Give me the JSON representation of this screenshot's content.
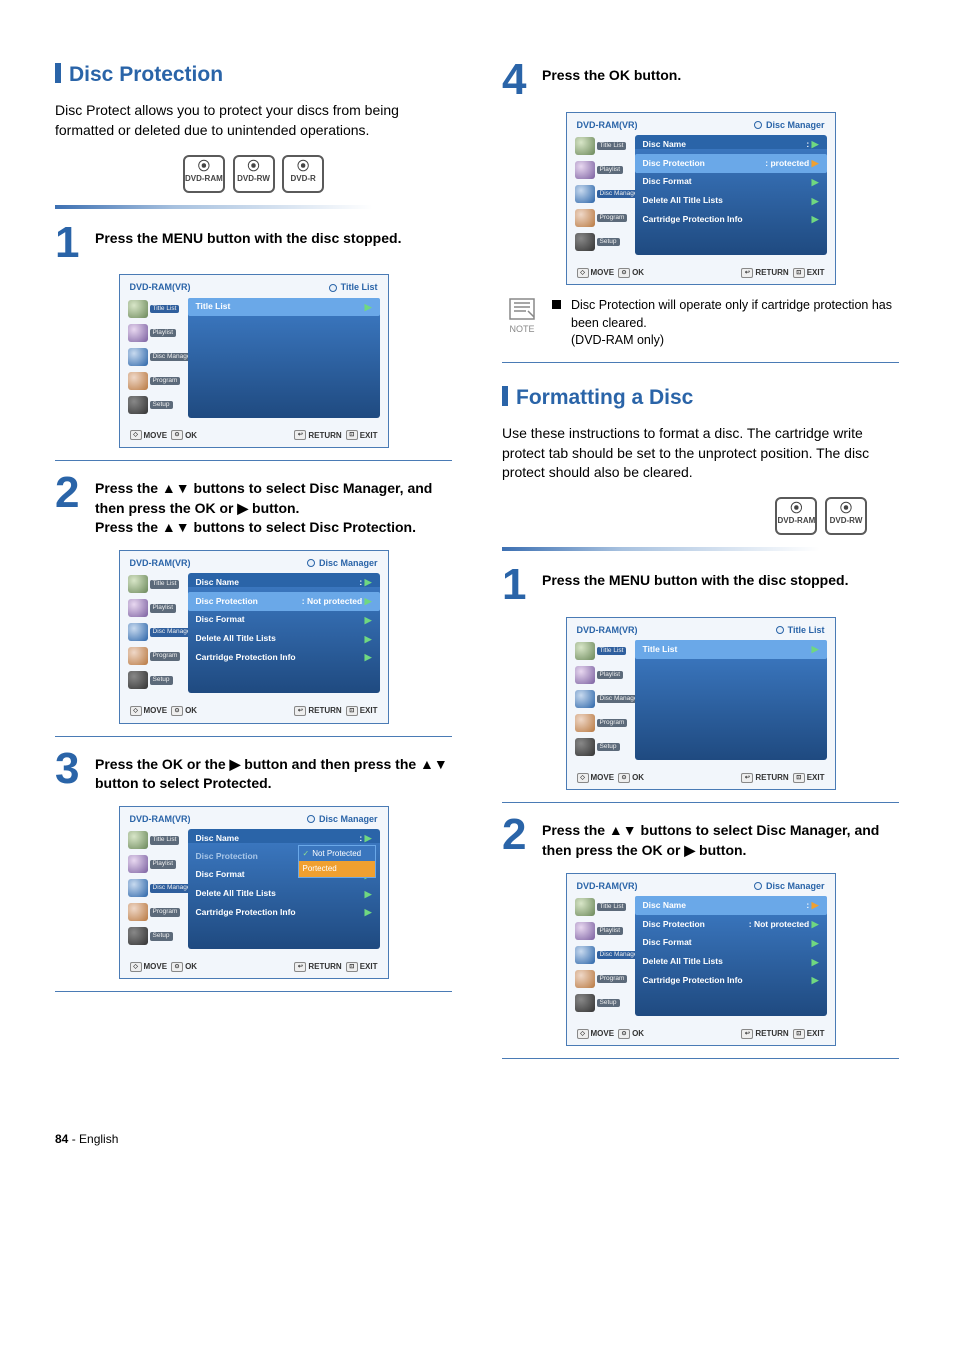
{
  "sections": {
    "disc_protection": {
      "title": "Disc Protection",
      "intro": "Disc Protect allows you to protect your discs from being formatted or deleted due to unintended operations.",
      "badges": [
        "DVD-RAM",
        "DVD-RW",
        "DVD-R"
      ]
    },
    "formatting": {
      "title": "Formatting a Disc",
      "intro": "Use these instructions to format a disc. The cartridge write protect tab should be set to the unprotect position. The disc protect should also be cleared.",
      "badges": [
        "DVD-RAM",
        "DVD-RW"
      ]
    }
  },
  "left_steps": {
    "s1": {
      "num": "1",
      "text": "Press the MENU button with the disc stopped."
    },
    "s2": {
      "num": "2",
      "text1": "Press the ▲▼ buttons to select Disc Manager, and then press the OK or ",
      "text1b": " button.",
      "text2": "Press the ▲▼ buttons to select Disc Protection."
    },
    "s3": {
      "num": "3",
      "text1": "Press the OK or the ",
      "text1b": " button and then press the ▲▼ button to select Protected."
    }
  },
  "right_steps": {
    "s4": {
      "num": "4",
      "text": "Press the OK button."
    },
    "s1": {
      "num": "1",
      "text": "Press the MENU button with the disc stopped."
    },
    "s2": {
      "num": "2",
      "text1": "Press the ▲▼ buttons to select Disc Manager, and then press the OK or ",
      "text1b": " button."
    }
  },
  "note": {
    "label": "NOTE",
    "text": "Disc Protection will operate only if cartridge protection has been cleared.",
    "sub": "(DVD-RAM only)"
  },
  "osd_common": {
    "mode": "DVD-RAM(VR)",
    "nav": [
      "Title List",
      "Playlist",
      "Disc Manager",
      "Program",
      "Setup"
    ],
    "foot": {
      "move": "MOVE",
      "ok": "OK",
      "return": "RETURN",
      "exit": "EXIT"
    }
  },
  "osd1": {
    "crumb": "Title List",
    "rows": [
      {
        "l": "Title List",
        "r": ""
      }
    ]
  },
  "osd_dm_unprot": {
    "crumb": "Disc Manager",
    "rows": [
      {
        "l": "Disc Name",
        "r": ":"
      },
      {
        "l": "Disc Protection",
        "r": ": Not protected",
        "hi": true
      },
      {
        "l": "Disc Format",
        "r": ""
      },
      {
        "l": "Delete All Title Lists",
        "r": ""
      },
      {
        "l": "Cartridge Protection Info",
        "r": ""
      }
    ]
  },
  "osd_dm_dd": {
    "crumb": "Disc Manager",
    "rows": [
      {
        "l": "Disc Name",
        "r": ":"
      },
      {
        "l": "Disc Protection",
        "r": "",
        "dim": true
      },
      {
        "l": "Disc Format",
        "r": ""
      },
      {
        "l": "Delete All Title Lists",
        "r": ""
      },
      {
        "l": "Cartridge Protection Info",
        "r": ""
      }
    ],
    "dd": [
      {
        "t": "Not Protected",
        "chk": true
      },
      {
        "t": "Portected",
        "sel": true
      }
    ]
  },
  "osd_dm_prot": {
    "crumb": "Disc Manager",
    "rows": [
      {
        "l": "Disc Name",
        "r": ":"
      },
      {
        "l": "Disc Protection",
        "r": ": protected",
        "hi": true
      },
      {
        "l": "Disc Format",
        "r": ""
      },
      {
        "l": "Delete All Title Lists",
        "r": ""
      },
      {
        "l": "Cartridge Protection Info",
        "r": ""
      }
    ]
  },
  "osd_dm_name": {
    "crumb": "Disc Manager",
    "rows": [
      {
        "l": "Disc Name",
        "r": ":",
        "hi": true
      },
      {
        "l": "Disc Protection",
        "r": ": Not protected"
      },
      {
        "l": "Disc Format",
        "r": ""
      },
      {
        "l": "Delete All Title Lists",
        "r": ""
      },
      {
        "l": "Cartridge Protection Info",
        "r": ""
      }
    ]
  },
  "footer": {
    "page": "84",
    "lang": "- English"
  }
}
